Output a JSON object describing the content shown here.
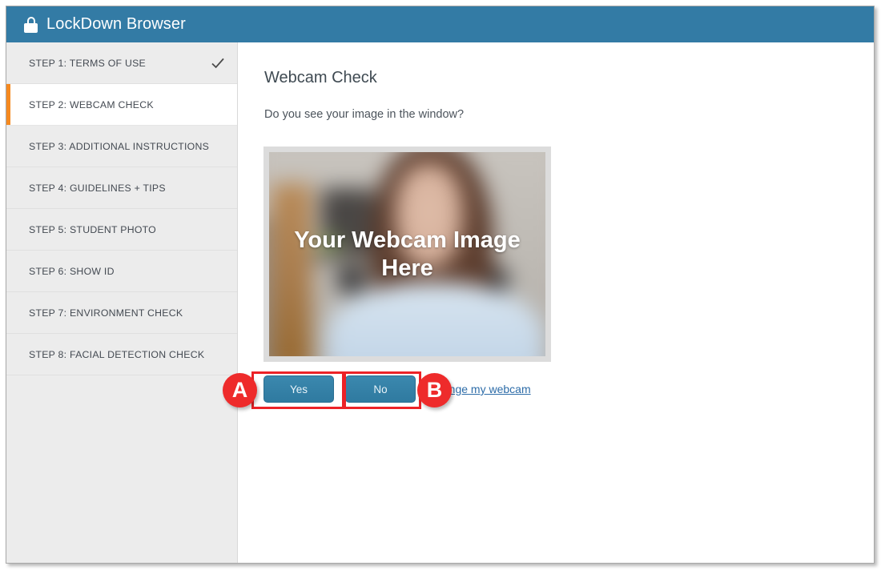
{
  "window": {
    "title": "LockDown Browser",
    "lock_icon": "lock-icon",
    "header_color": "#337ba5"
  },
  "sidebar": {
    "active_index": 1,
    "accent_color": "#f5891f",
    "background_color": "#ececec",
    "items": [
      {
        "label": "STEP 1: TERMS OF USE",
        "completed": true,
        "active": false,
        "icon": "check-icon"
      },
      {
        "label": "STEP 2: WEBCAM CHECK",
        "completed": false,
        "active": true
      },
      {
        "label": "STEP 3: ADDITIONAL INSTRUCTIONS",
        "completed": false,
        "active": false
      },
      {
        "label": "STEP 4: GUIDELINES + TIPS",
        "completed": false,
        "active": false
      },
      {
        "label": "STEP 5: STUDENT PHOTO",
        "completed": false,
        "active": false
      },
      {
        "label": "STEP 6: SHOW ID",
        "completed": false,
        "active": false
      },
      {
        "label": "STEP 7: ENVIRONMENT CHECK",
        "completed": false,
        "active": false
      },
      {
        "label": "STEP 8: FACIAL DETECTION CHECK",
        "completed": false,
        "active": false
      }
    ]
  },
  "main": {
    "page_title": "Webcam Check",
    "question": "Do you see your image in the window?",
    "webcam": {
      "overlay_line1": "Your Webcam Image",
      "overlay_line2": "Here"
    },
    "buttons": {
      "yes_label": "Yes",
      "no_label": "No",
      "button_color": "#2f7aa0"
    },
    "change_webcam_link": "Change my webcam",
    "link_color": "#2d6ca8"
  },
  "annotations": {
    "color": "#ec2227",
    "badge_color": "#ee2b2b",
    "badges": [
      {
        "label": "A",
        "target": "yes-button"
      },
      {
        "label": "B",
        "target": "no-button"
      }
    ]
  }
}
